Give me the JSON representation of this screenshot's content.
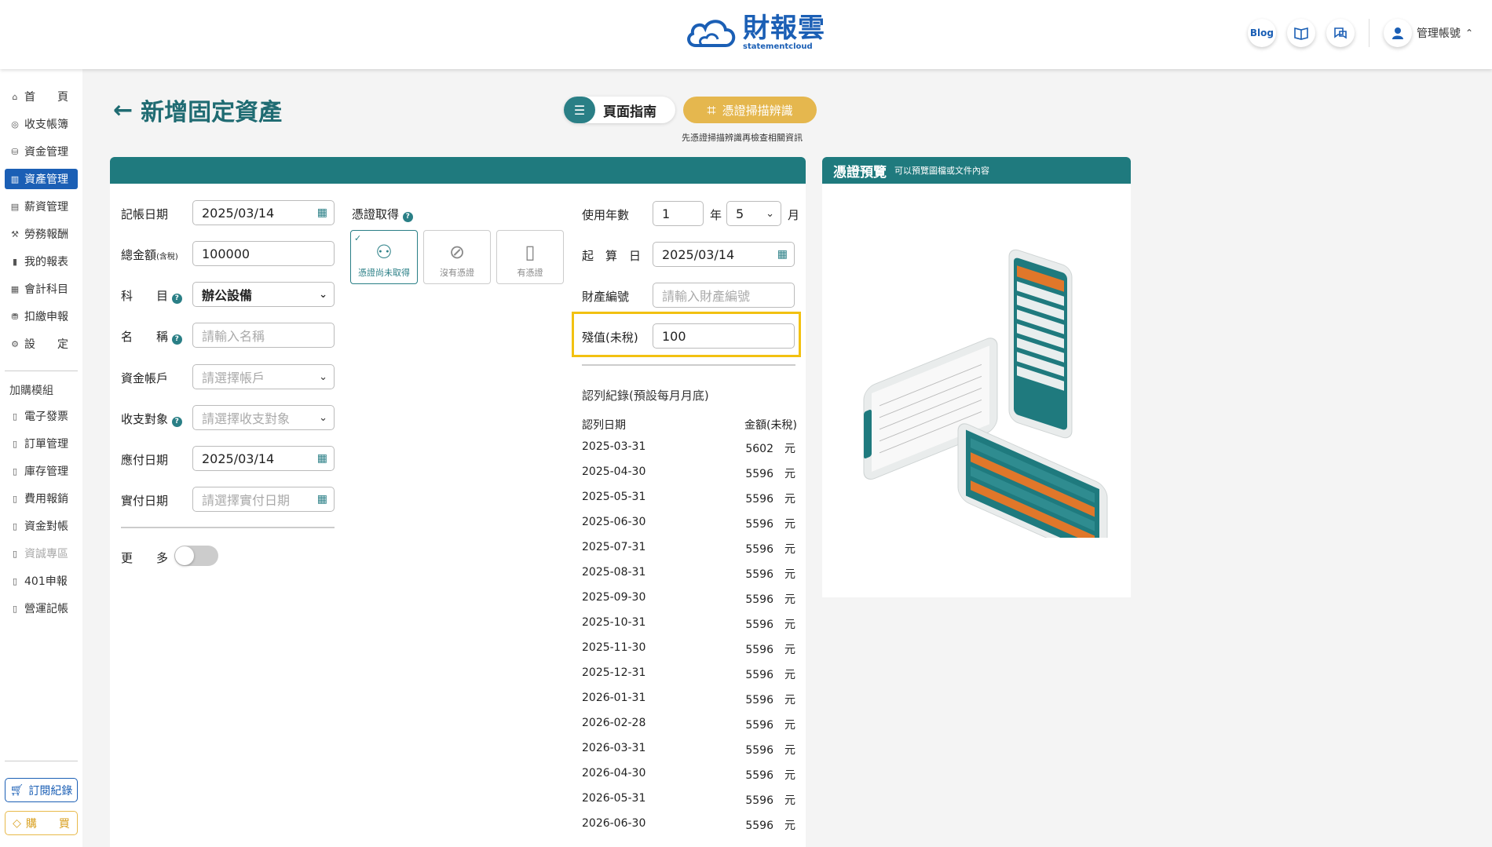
{
  "brand": {
    "name_cn": "財報雲",
    "name_en": "statementcloud"
  },
  "header": {
    "blog_label": "Blog",
    "account_label": "管理帳號"
  },
  "sidebar": {
    "items": [
      {
        "label": "首　　頁",
        "icon": "home-icon"
      },
      {
        "label": "收支帳簿",
        "icon": "ledger-icon"
      },
      {
        "label": "資金管理",
        "icon": "funds-icon"
      },
      {
        "label": "資產管理",
        "icon": "assets-icon",
        "active": true
      },
      {
        "label": "薪資管理",
        "icon": "payroll-icon"
      },
      {
        "label": "勞務報酬",
        "icon": "labor-icon"
      },
      {
        "label": "我的報表",
        "icon": "report-icon"
      },
      {
        "label": "會計科目",
        "icon": "accounts-icon"
      },
      {
        "label": "扣繳申報",
        "icon": "withholding-icon"
      },
      {
        "label": "設　　定",
        "icon": "settings-icon"
      }
    ],
    "addon_title": "加購模組",
    "addons": [
      {
        "label": "電子發票",
        "disabled": false
      },
      {
        "label": "訂單管理",
        "disabled": false
      },
      {
        "label": "庫存管理",
        "disabled": false
      },
      {
        "label": "費用報銷",
        "disabled": false
      },
      {
        "label": "資金對帳",
        "disabled": false
      },
      {
        "label": "資誠專區",
        "disabled": true
      },
      {
        "label": "401申報",
        "disabled": false
      },
      {
        "label": "營運記帳",
        "disabled": false
      }
    ],
    "subscription_label": "訂閱紀錄",
    "buy_label": "購　　買"
  },
  "page": {
    "title": "新增固定資產",
    "guide_label": "頁面指南",
    "scan_label": "憑證掃描辨識",
    "scan_hint": "先憑證掃描辨識再檢查相關資訊"
  },
  "form": {
    "record_date_label": "記帳日期",
    "record_date": "2025/03/14",
    "total_label": "總金額",
    "total_suffix": "(含稅)",
    "total": "100000",
    "subject_label": "科　　目",
    "subject": "辦公設備",
    "name_label": "名　　稱",
    "name_placeholder": "請輸入名稱",
    "account_label": "資金帳戶",
    "account_placeholder": "請選擇帳戶",
    "party_label": "收支對象",
    "party_placeholder": "請選擇收支對象",
    "payable_label": "應付日期",
    "payable_date": "2025/03/14",
    "paid_label": "實付日期",
    "paid_placeholder": "請選擇實付日期",
    "more_label": "更　　多"
  },
  "voucher": {
    "label": "憑證取得",
    "options": [
      {
        "label": "憑證尚未取得",
        "selected": true
      },
      {
        "label": "沒有憑證",
        "selected": false
      },
      {
        "label": "有憑證",
        "selected": false
      }
    ]
  },
  "life": {
    "years_label": "使用年數",
    "years": "1",
    "year_unit": "年",
    "months": "5",
    "month_unit": "月",
    "start_label": "起　算　日",
    "start_date": "2025/03/14",
    "asset_no_label": "財產編號",
    "asset_no_placeholder": "請輸入財產編號",
    "residual_label": "殘值(未稅)",
    "residual": "100"
  },
  "depreciation": {
    "title": "認列紀錄(預設每月月底)",
    "date_header": "認列日期",
    "amount_header": "金額(未稅)",
    "rows": [
      {
        "date": "2025-03-31",
        "amount": "5602　元"
      },
      {
        "date": "2025-04-30",
        "amount": "5596　元"
      },
      {
        "date": "2025-05-31",
        "amount": "5596　元"
      },
      {
        "date": "2025-06-30",
        "amount": "5596　元"
      },
      {
        "date": "2025-07-31",
        "amount": "5596　元"
      },
      {
        "date": "2025-08-31",
        "amount": "5596　元"
      },
      {
        "date": "2025-09-30",
        "amount": "5596　元"
      },
      {
        "date": "2025-10-31",
        "amount": "5596　元"
      },
      {
        "date": "2025-11-30",
        "amount": "5596　元"
      },
      {
        "date": "2025-12-31",
        "amount": "5596　元"
      },
      {
        "date": "2026-01-31",
        "amount": "5596　元"
      },
      {
        "date": "2026-02-28",
        "amount": "5596　元"
      },
      {
        "date": "2026-03-31",
        "amount": "5596　元"
      },
      {
        "date": "2026-04-30",
        "amount": "5596　元"
      },
      {
        "date": "2026-05-31",
        "amount": "5596　元"
      },
      {
        "date": "2026-06-30",
        "amount": "5596　元"
      }
    ]
  },
  "preview": {
    "title": "憑證預覽",
    "subtitle": "可以預覽圖檔或文件內容"
  },
  "colors": {
    "primary": "#1f7a7e",
    "brand_blue": "#1b5fb5",
    "accent_gold": "#e5b74e",
    "highlight": "#f2c111"
  }
}
